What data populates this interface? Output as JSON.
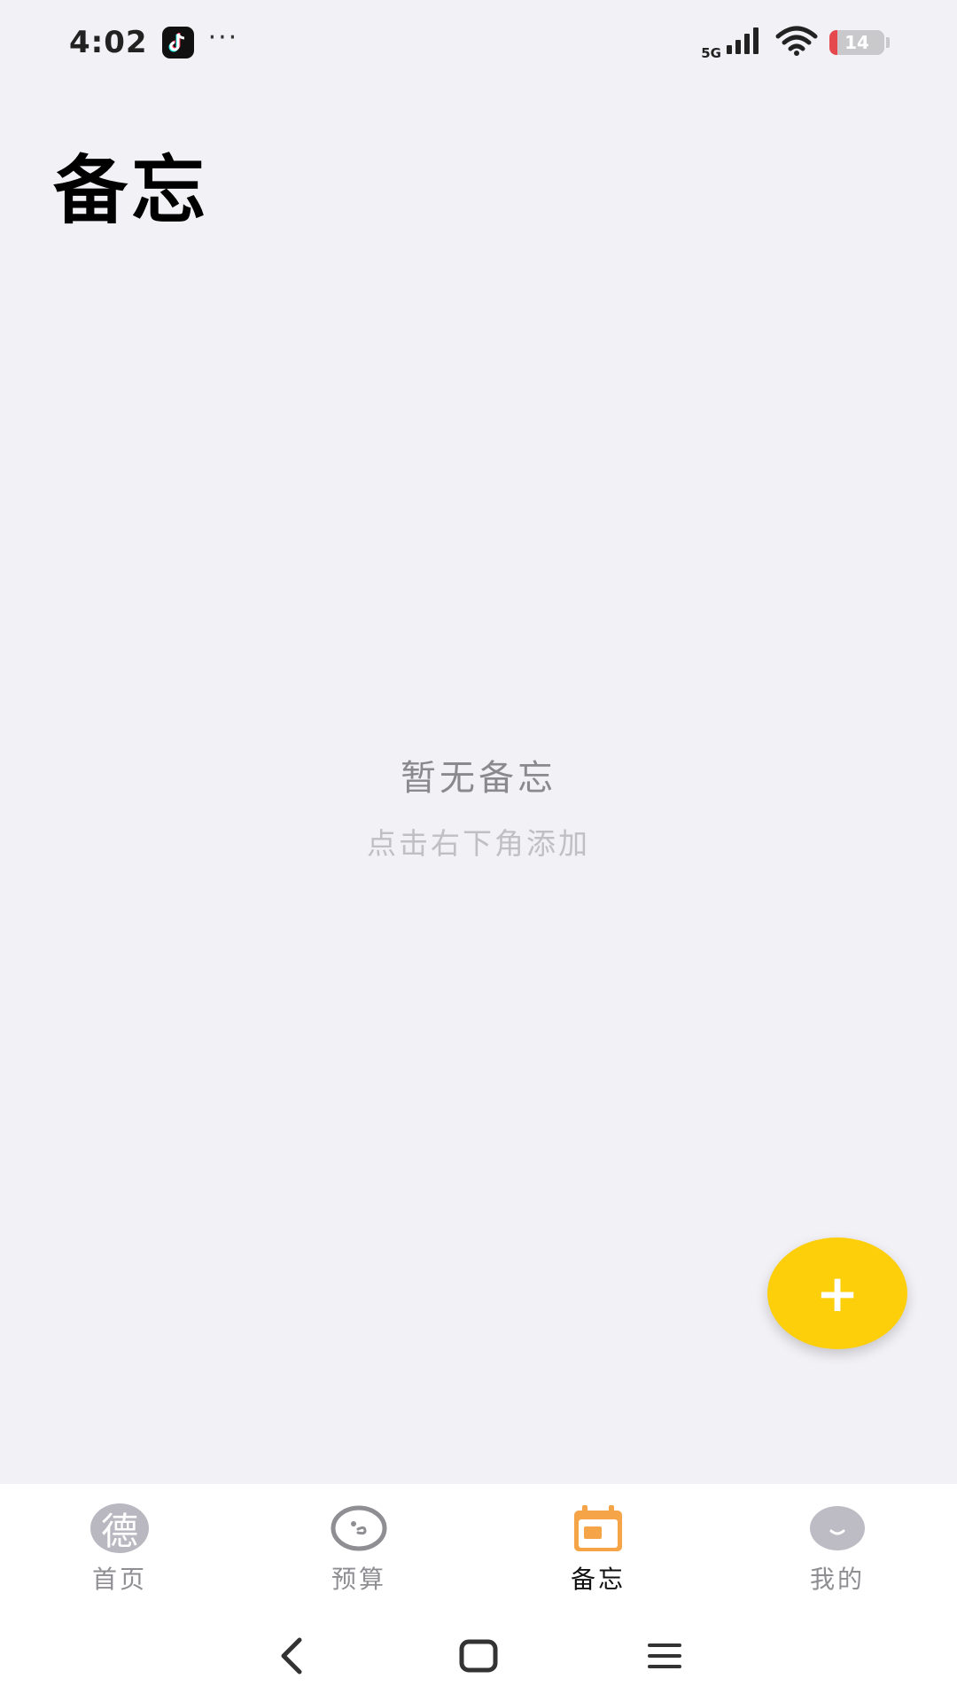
{
  "status_bar": {
    "time": "4:02",
    "network": "5G",
    "battery_level": "14",
    "battery_color": "#e5484d"
  },
  "page": {
    "title": "备忘"
  },
  "empty_state": {
    "title": "暂无备忘",
    "hint": "点击右下角添加"
  },
  "fab": {
    "label": "+",
    "color": "#fdce0a"
  },
  "tabs": [
    {
      "label": "首页",
      "icon": "avatar-de-icon",
      "avatar_text": "德",
      "active": false
    },
    {
      "label": "预算",
      "icon": "budget-face-icon",
      "active": false
    },
    {
      "label": "备忘",
      "icon": "calendar-icon",
      "active": true,
      "accent": "#f5a447"
    },
    {
      "label": "我的",
      "icon": "profile-avatar-icon",
      "active": false
    }
  ],
  "system_nav": {
    "buttons": [
      "back-icon",
      "home-icon",
      "menu-icon"
    ]
  }
}
